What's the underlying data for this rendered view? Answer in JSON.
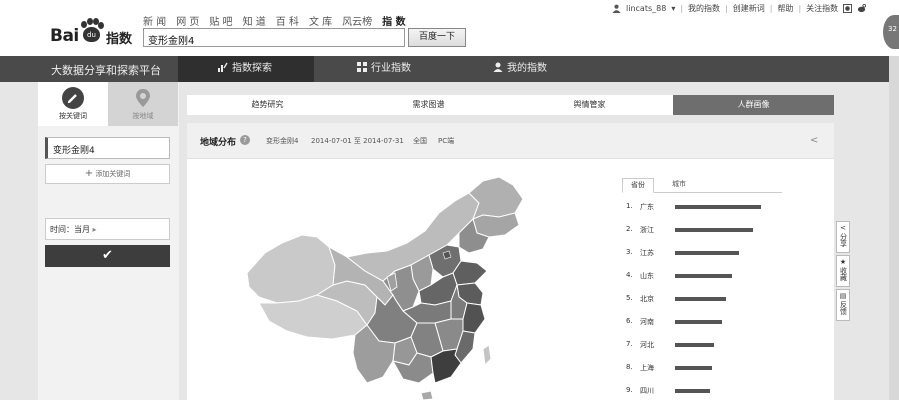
{
  "header": {
    "logo": {
      "text_bai": "Bai",
      "text_du": "du",
      "text_zhishu": "指数"
    },
    "topnav": [
      "新 闻",
      "网 页",
      "贴 吧",
      "知 道",
      "百 科",
      "文 库",
      "风云榜",
      "指 数"
    ],
    "topnav_active_index": 7,
    "search": {
      "value": "变形金刚4",
      "button_label": "百度一下"
    },
    "user": {
      "username": "lincats_88",
      "links": [
        "我的指数",
        "创建新词",
        "帮助",
        "关注指数"
      ]
    },
    "scroll_knob_label": "32"
  },
  "darknav": {
    "tagline": "大数据分享和探索平台",
    "items": [
      {
        "label": "指数探索",
        "icon": "bar-chart-icon",
        "active": true
      },
      {
        "label": "行业指数",
        "icon": "grid-icon",
        "active": false
      },
      {
        "label": "我的指数",
        "icon": "user-icon",
        "active": false
      }
    ]
  },
  "leftpanel": {
    "tabs": [
      {
        "label": "按关键词",
        "icon": "edit-icon",
        "active": true
      },
      {
        "label": "按地域",
        "icon": "map-pin-icon",
        "active": false
      }
    ],
    "keyword": "变形金刚4",
    "add_keyword_label": "添加关键词",
    "time_label": "时间：当月",
    "confirm_icon": "check-icon"
  },
  "main": {
    "tabs": [
      {
        "label": "趋势研究",
        "active": false
      },
      {
        "label": "需求图谱",
        "active": false
      },
      {
        "label": "舆情管家",
        "active": false
      },
      {
        "label": "人群画像",
        "active": true
      }
    ],
    "card": {
      "title": "地域分布",
      "keyword": "变形金刚4",
      "date_range": "2014-07-01 至 2014-07-31",
      "scope": "全国",
      "device": "PC端"
    },
    "ranking": {
      "tabs": [
        "省份",
        "城市"
      ],
      "active_tab": 0,
      "rows": [
        {
          "rank": "1.",
          "name": "广东",
          "value": 0.95
        },
        {
          "rank": "2.",
          "name": "浙江",
          "value": 0.87
        },
        {
          "rank": "3.",
          "name": "江苏",
          "value": 0.71
        },
        {
          "rank": "4.",
          "name": "山东",
          "value": 0.63
        },
        {
          "rank": "5.",
          "name": "北京",
          "value": 0.57
        },
        {
          "rank": "6.",
          "name": "河南",
          "value": 0.52
        },
        {
          "rank": "7.",
          "name": "河北",
          "value": 0.43
        },
        {
          "rank": "8.",
          "name": "上海",
          "value": 0.41
        },
        {
          "rank": "9.",
          "name": "四川",
          "value": 0.39
        }
      ]
    }
  },
  "side_tools": [
    {
      "label": "分享",
      "icon": "share-icon"
    },
    {
      "label": "收藏",
      "icon": "star-icon"
    },
    {
      "label": "反馈",
      "icon": "feedback-icon"
    }
  ],
  "colors": {
    "dark_nav": "#4a4a4a",
    "active_tab": "#6e6e6e",
    "bar": "#555555"
  }
}
